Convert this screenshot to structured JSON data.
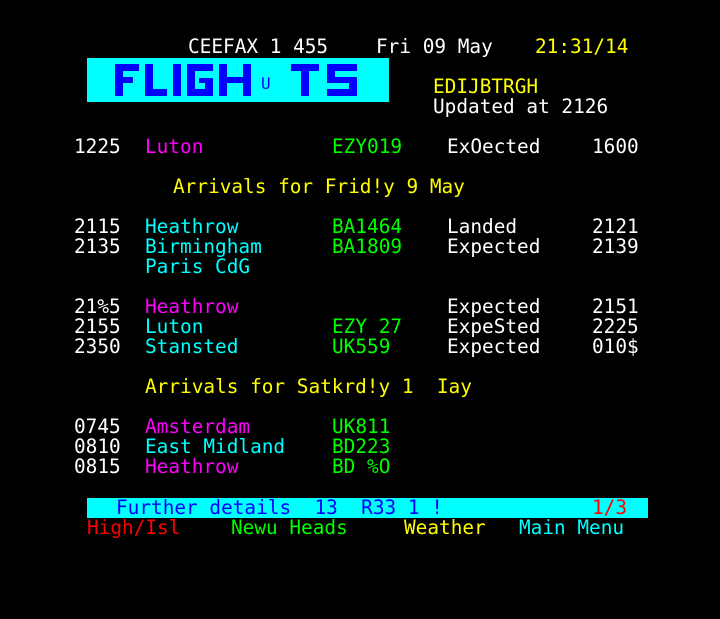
{
  "header": {
    "service": "CEEFAX 1 455",
    "date": "Fri 09 May",
    "time": "21:31/14"
  },
  "logo": {
    "text": "FLIGHTS",
    "mark": "U"
  },
  "airport": {
    "code": "EDIJBTRGH",
    "updated": "Updated at 2126"
  },
  "top_flight": {
    "time": "1225",
    "place": "Luton",
    "flight": "EZY019",
    "status": "ExOected",
    "at": "1600"
  },
  "section1": {
    "title": "Arrivals for Frid!y 9 May"
  },
  "group1": [
    {
      "time": "2115",
      "place": "Heathrow",
      "flight": "BA1464",
      "status": "Landed",
      "at": "2121"
    },
    {
      "time": "2135",
      "place": "Birmingham",
      "flight": "BA1809",
      "status": "Expected",
      "at": "2139"
    },
    {
      "time": "",
      "place": "Paris CdG",
      "flight": "",
      "status": "",
      "at": ""
    }
  ],
  "group2": [
    {
      "time": "21%5",
      "place": "Heathrow",
      "flight": "",
      "status": "Expected",
      "at": "2151"
    },
    {
      "time": "2155",
      "place": "Luton",
      "flight": "EZY 27",
      "status": "ExpeSted",
      "at": "2225"
    },
    {
      "time": "2350",
      "place": "Stansted",
      "flight": "UK559",
      "status": "Expected",
      "at": "010$"
    }
  ],
  "section2": {
    "title": "Arrivals for Satkrd!y 1  Iay"
  },
  "group3": [
    {
      "time": "0745",
      "place": "Amsterdam",
      "flight": "UK811"
    },
    {
      "time": "0810",
      "place": "East Midland",
      "flight": "BD223"
    },
    {
      "time": "0815",
      "place": "Heathrow",
      "flight": "BD %O"
    }
  ],
  "footer": {
    "details": "Further details  13  R33 1 !",
    "page_counter": "1/3",
    "fastext": {
      "red": "High/Isl",
      "green": "Newu Heads",
      "yellow": "Weather",
      "cyan": "Main Menu"
    }
  },
  "colors": {
    "background": "#000000",
    "white": "#ffffff",
    "yellow": "#ffff00",
    "cyan": "#00ffff",
    "magenta": "#ff00ff",
    "green": "#00ff00",
    "red": "#ff0000",
    "blue": "#0000ff"
  }
}
